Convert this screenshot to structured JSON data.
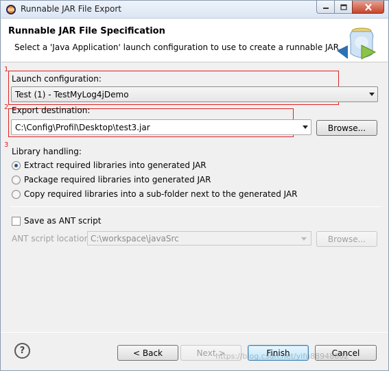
{
  "window": {
    "title": "Runnable JAR File Export",
    "controls": {
      "minimize_icon": "minimize-icon",
      "maximize_icon": "maximize-icon",
      "close_icon": "close-icon"
    }
  },
  "header": {
    "title": "Runnable JAR File Specification",
    "description": "Select a 'Java Application' launch configuration to use to create a runnable JAR."
  },
  "annotations": {
    "one": "1",
    "two": "2",
    "three": "3",
    "highlight_color": "#e02020"
  },
  "launch": {
    "label": "Launch configuration:",
    "value": "Test (1) - TestMyLog4jDemo"
  },
  "export": {
    "label": "Export destination:",
    "value": "C:\\Config\\Profil\\Desktop\\test3.jar",
    "browse_label": "Browse..."
  },
  "library": {
    "label": "Library handling:",
    "options": [
      {
        "label": "Extract required libraries into generated JAR",
        "selected": true
      },
      {
        "label": "Package required libraries into generated JAR",
        "selected": false
      },
      {
        "label": "Copy required libraries into a sub-folder next to the generated JAR",
        "selected": false
      }
    ]
  },
  "ant": {
    "checkbox_label": "Save as ANT script",
    "checked": false,
    "location_label": "ANT script location:",
    "location_value": "C:\\workspace\\javaSrc",
    "browse_label": "Browse..."
  },
  "footer": {
    "help_icon": "?",
    "back_label": "< Back",
    "next_label": "Next >",
    "finish_label": "Finish",
    "cancel_label": "Cancel",
    "watermark": "https://blog.csdn.net/yifu88948862"
  }
}
